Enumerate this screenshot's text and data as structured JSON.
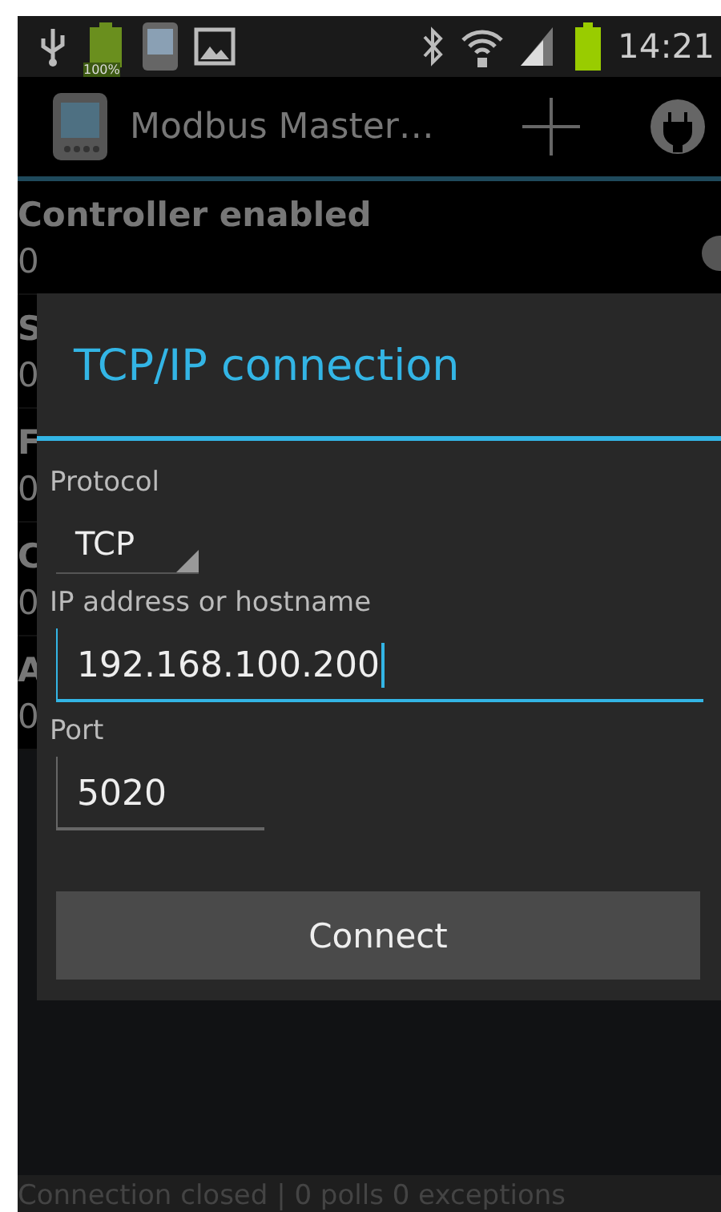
{
  "status_bar": {
    "battery_text": "100%",
    "time": "14:21"
  },
  "action_bar": {
    "title": "Modbus Master…"
  },
  "list": [
    {
      "label": "Controller enabled",
      "value": "0"
    },
    {
      "label": "S",
      "value": "0"
    },
    {
      "label": "F",
      "value": "0"
    },
    {
      "label": "C",
      "value": "0"
    },
    {
      "label": "A",
      "value": "0"
    }
  ],
  "dialog": {
    "title": "TCP/IP connection",
    "fields": [
      {
        "kind": "spinner",
        "label": "Protocol",
        "value": "TCP",
        "focused": false
      },
      {
        "kind": "text",
        "label": "IP address or hostname",
        "value": "192.168.100.200",
        "focused": true
      },
      {
        "kind": "text",
        "label": "Port",
        "value": "5020",
        "focused": false
      }
    ],
    "button": "Connect"
  },
  "footer": "Connection closed | 0 polls 0 exceptions"
}
